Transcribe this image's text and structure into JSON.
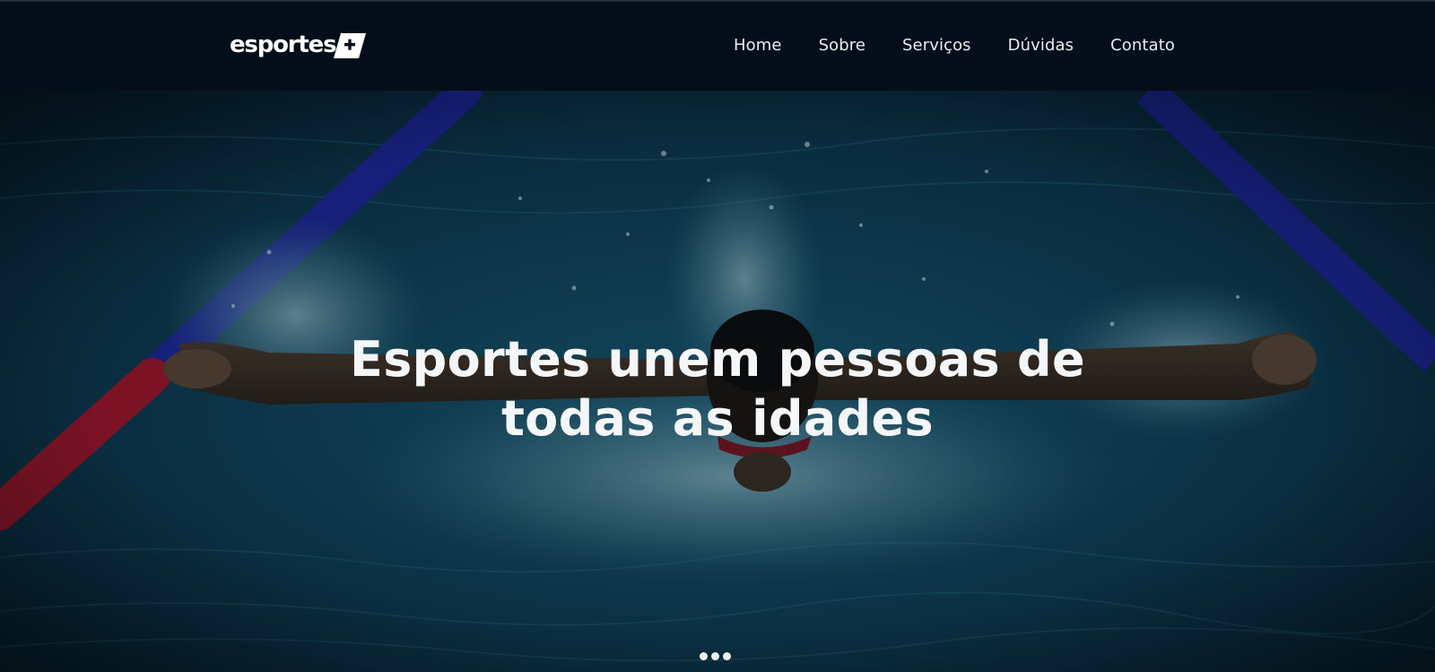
{
  "brand": {
    "logo_text": "esportes",
    "logo_symbol": "plus-badge-icon"
  },
  "nav": {
    "items": [
      {
        "label": "Home"
      },
      {
        "label": "Sobre"
      },
      {
        "label": "Serviços"
      },
      {
        "label": "Dúvidas"
      },
      {
        "label": "Contato"
      }
    ]
  },
  "hero": {
    "title_line_1": "Esportes unem pessoas de",
    "title_line_2": "todas as idades",
    "background": "swimmer-butterfly-stroke-photo",
    "slides": 3
  },
  "colors": {
    "header_bg": "#040e1a",
    "text": "#ffffff",
    "water": "#0b3a52",
    "lane_blue": "#1f2aa8",
    "lane_red": "#b0162a"
  }
}
